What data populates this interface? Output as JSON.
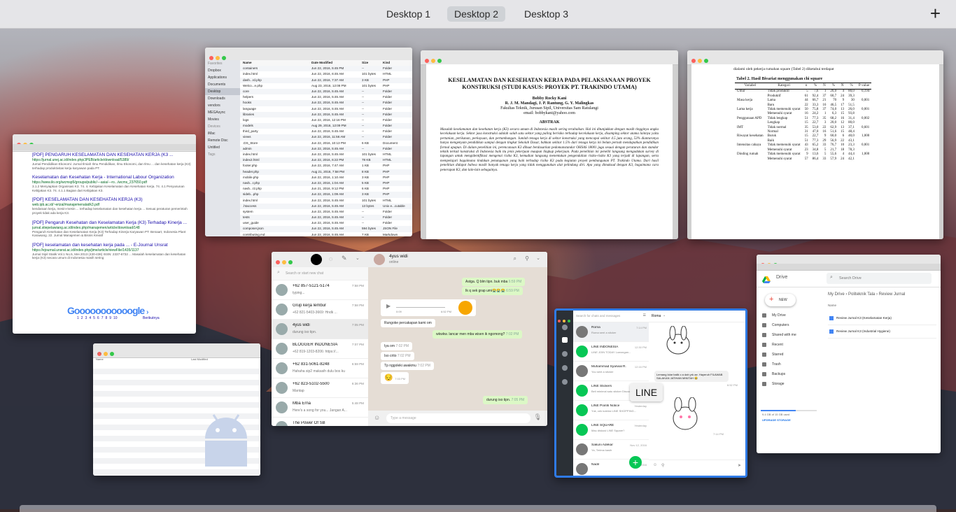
{
  "spaces": {
    "tabs": [
      {
        "label": "Desktop 1",
        "active": false
      },
      {
        "label": "Desktop 2",
        "active": true
      },
      {
        "label": "Desktop 3",
        "active": false
      }
    ],
    "add_label": "+"
  },
  "finder": {
    "sidebar": [
      "Favorites",
      "Dropbox",
      "Applications",
      "Documents",
      "Desktop",
      "Downloads",
      "vendors",
      "MEGAsync",
      "Movies",
      "Devices",
      "iMac",
      "Remote Disc",
      "Untitled",
      "Tags"
    ],
    "columns": [
      "Name",
      "Date Modified",
      "Size",
      "Kind"
    ],
    "rows": [
      [
        "containers",
        "Jun 22, 2016, 5:45 PM",
        "--",
        "Folder"
      ],
      [
        "index.html",
        "Jun 22, 2016, 6:45 AM",
        "101 bytes",
        "HTML"
      ],
      [
        "dash...rd.php",
        "Jun 22, 2016, 7:37 AM",
        "3 KB",
        "PHP"
      ],
      [
        "Welco...e.php",
        "Aug 23, 2016, 12:08 PM",
        "101 bytes",
        "PHP"
      ],
      [
        "core",
        "Jun 22, 2016, 5:45 AM",
        "--",
        "Folder"
      ],
      [
        "helpers",
        "Jun 22, 2016, 5:45 AM",
        "--",
        "Folder"
      ],
      [
        "hooks",
        "Jun 22, 2016, 5:45 AM",
        "--",
        "Folder"
      ],
      [
        "language",
        "Jun 22, 2016, 5:45 AM",
        "--",
        "Folder"
      ],
      [
        "libraries",
        "Jun 22, 2016, 5:45 AM",
        "--",
        "Folder"
      ],
      [
        "logs",
        "Jun 22, 2016, 12:16 PM",
        "--",
        "Folder"
      ],
      [
        "models",
        "Aug 29, 2016, 12:09 PM",
        "--",
        "Folder"
      ],
      [
        "third_party",
        "Jun 22, 2016, 5:45 AM",
        "--",
        "Folder"
      ],
      [
        "views",
        "Jun 22, 2016, 11:56 AM",
        "--",
        "Folder"
      ],
      [
        ".DS_Store",
        "Jun 22, 2016, 10:13 PM",
        "6 KB",
        "Document"
      ],
      [
        "admin",
        "Jun 22, 2016, 5:45 AM",
        "--",
        "Folder"
      ],
      [
        "index.html",
        "Jun 22, 2016, 5:45 AM",
        "101 bytes",
        "HTML"
      ],
      [
        "index2.html",
        "Jun 22, 2016, 6:22 PM",
        "78 KB",
        "HTML"
      ],
      [
        "footer.php",
        "Jun 22, 2016, 7:47 AM",
        "1 KB",
        "PHP"
      ],
      [
        "header.php",
        "Aug 21, 2016, 7:58 PM",
        "8 KB",
        "PHP"
      ],
      [
        "mobile.php",
        "Jun 22, 2016, 1:10 AM",
        "3 KB",
        "PHP"
      ],
      [
        "navb...r.php",
        "Jun 22, 2016, 1:04 AM",
        "5 KB",
        "PHP"
      ],
      [
        "navb...r2.php",
        "Jun 21, 2016, 9:12 PM",
        "6 KB",
        "PHP"
      ],
      [
        "sideb...php",
        "Jun 22, 2016, 1:09 AM",
        "3 KB",
        "PHP"
      ],
      [
        "index.html",
        "Jun 22, 2016, 5:45 AM",
        "101 bytes",
        "HTML"
      ],
      [
        ".htaccess",
        "Jun 22, 2016, 5:45 AM",
        "13 bytes",
        "Unix e...cutable"
      ],
      [
        "system",
        "Jun 22, 2016, 5:45 AM",
        "--",
        "Folder"
      ],
      [
        "tests",
        "Jun 22, 2016, 5:45 AM",
        "--",
        "Folder"
      ],
      [
        "user_guide",
        "Jun 22, 2016, 5:45 AM",
        "--",
        "Folder"
      ],
      [
        "composer.json",
        "Jun 22, 2016, 5:45 AM",
        "594 bytes",
        "JSON File"
      ],
      [
        "contributing.md",
        "Jun 22, 2016, 5:45 AM",
        "7 KB",
        "Markdown"
      ],
      [
        "index.php",
        "Jun 22, 2016, 5:45 AM",
        "10 KB",
        "PHP"
      ],
      [
        "license.txt",
        "Jun 22, 2016, 5:45 AM",
        "3 KB",
        "Plain Text"
      ],
      [
        "Screen S...3.49 PM.png",
        "Jun 23, 2016, 3:49 PM",
        "32 KB",
        "PNG image"
      ]
    ]
  },
  "pdf1": {
    "title": "KESELAMATAN DAN KESEHATAN KERJA PADA PELAKSANAAN PROYEK KONSTRUKSI (STUDI KASUS: PROYEK PT. TRAKINDO UTAMA)",
    "author": "Bobby Rocky Kani",
    "authors2": "R. J. M. Mandagi, J. P. Rantung, G. Y. Malingkas",
    "affiliation": "Fakultas Teknik, Jurusan Sipil, Universitas Sam Ratulangi",
    "email": "email: bobbykani@yahoo.com",
    "abstract_head": "ABSTRAK",
    "abstract": "Masalah keselamatan dan kesehatan kerja (K3) secara umum di Indonesia masih sering terabaikan. Hal ini ditunjukkan dengan masih tingginya angka kecelakaan kerja. Sektor jasa konstruksi adalah salah satu sektor yang paling berisiko terhadap kecelakaan kerja, disamping sektor utama lainnya yaitu pertanian, perikanan, perkayuan, dan pertambangan. Jumlah tenaga kerja di sektor konstruksi yang mencapai sekitar 4.5 juta orang, 53% diantaranya hanya mengenyam pendidikan sampai dengan tingkat Sekolah Dasar, bahkan sekitar 1.5% dari tenaga kerja ini belum pernah mendapatkan pendidikan formal apapun. Di dalam penelitian ini, perencanaan K3 dibuat berdasarkan pedomanstandar OHSAS 18001 juga sesuai dengan peraturan dan standar teknik terkait konstruksi di Indonesia baik itu jenis pekerjaan maupun lingkup pekerjaan. Pada penelitian ini peneliti langsung mengadakan survey di lapangan untuk mengidentifikasi mengenai risiko K3, kemudian langsung menentukan pengendalian risiko-risiko K3 yang terjadi di lapangan, serta mempelajari bagaimana tindakan penanganan yang baik terhadap risiko K3 pada kegiatan proyek pembangunan PT. Trakindo Utama. Dari hasil penelitian didapat bahwa masih banyak tenaga kerja yang tidak menggunakan alat pelindung diri. Apa yang dimaksud dengan K3, bagaimana cara penerapan K3, dan lain-lain sebagainya."
  },
  "pdf2": {
    "intro": "dialami oleh pekerja rumahan square (Tabel 2) diketahui terdapat",
    "table_title": "Tabel 2. Hasil Bivariat menggunakan chi square",
    "headers": [
      "Variabel",
      "Kategori",
      "n",
      "%",
      "N",
      "%",
      "N",
      "%",
      "P-value"
    ],
    "rows": [
      [
        "Umur",
        "Tidak produktif",
        "5",
        "7,6",
        "1",
        "20,0",
        "4",
        "80,0",
        "0,194"
      ],
      [
        "",
        "Produktif",
        "61",
        "92,4",
        "37",
        "60,7",
        "24",
        "39,3",
        ""
      ],
      [
        "Masa kerja",
        "Lama",
        "44",
        "66,7",
        "21",
        "70",
        "9",
        "30",
        "0,001"
      ],
      [
        "",
        "Baru",
        "22",
        "33,3",
        "16",
        "46,5",
        "17",
        "51,5",
        ""
      ],
      [
        "Lama kerja",
        "Tidak memenuhi syarat",
        "50",
        "75,8",
        "37",
        "74,0",
        "13",
        "26,0",
        "0,001"
      ],
      [
        "",
        "Memenuhi syarat",
        "16",
        "24,2",
        "1",
        "6,3",
        "15",
        "93,8",
        ""
      ],
      [
        "Penggunaan APD",
        "Tidak lengkap",
        "51",
        "77,3",
        "35",
        "68,2",
        "16",
        "31,4",
        "0,002"
      ],
      [
        "",
        "Lengkap",
        "15",
        "22,7",
        "3",
        "20,0",
        "12",
        "80,0",
        ""
      ],
      [
        "IMT",
        "Tidak normal",
        "35",
        "53,0",
        "22",
        "62,9",
        "13",
        "37,1",
        "0,601"
      ],
      [
        "",
        "Normal",
        "31",
        "47,0",
        "16",
        "51,6",
        "15",
        "48,4",
        ""
      ],
      [
        "Riwayat kesehatan",
        "Buruk",
        "15",
        "22,7",
        "9",
        "60,0",
        "6",
        "40,0",
        "1,000"
      ],
      [
        "",
        "Baik",
        "51",
        "77,3",
        "29",
        "56,9",
        "22",
        "43,1",
        ""
      ],
      [
        "Intensitas cahaya",
        "Tidak memenuhi syarat",
        "43",
        "65,2",
        "33",
        "76,7",
        "10",
        "23,3",
        "0,001"
      ],
      [
        "",
        "Memenuhi syarat",
        "23",
        "34,8",
        "5",
        "21,7",
        "18",
        "78,3",
        ""
      ],
      [
        "Dinding rumah",
        "Tidak memenuhi syarat",
        "9",
        "13,6",
        "5",
        "55,6",
        "4",
        "44,4",
        "1,000"
      ],
      [
        "",
        "Memenuhi syarat",
        "57",
        "86,4",
        "33",
        "57,9",
        "24",
        "42,1",
        ""
      ]
    ]
  },
  "google": {
    "results": [
      {
        "title": "[PDF] PENGARUH KESELAMATAN DAN KESEHATAN KERJA (K3 ...",
        "url": "https://jurnal.unej.ac.id/index.php/JPEB/article/download/5389/",
        "desc": "Jurnal Pendidikan Ekonomi: Jurnal Ilmiah Ilmu Pendidikan, Ilmu Ekonomi, dan Ilmu ... dan kesehatan kerja (K3) terhadap produktivitas kerja karyawan pada PT."
      },
      {
        "title": "Keselamatan dan Kesehatan Kerja - International Labour Organization",
        "url": "https://www.ilo.org/wcmsp5/groups/public/---asia/---ro.../wcms_237650.pdf",
        "desc": "3.1.2 Menyiapkan Organisasi K3. 74. 4. Kebijakan Keselamatan dan Kesehatan Kerja. 74. 4.1 Penyusunan Kebijakan K3. 74. 4.1.1 Bagian dari Kebijakan K3."
      },
      {
        "title": "[PDF] KESELAMATAN DAN KESEHATAN KERJA (K3)",
        "url": "web.ipb.ac.id/~erizal/manajemenalat/k3.pdf",
        "desc": "kendaraan kerja, mesin-mesin ... terhadap keselamatan dan kesehatan kerja ... Sesuai peraturan pemerintah proyek tidak ada kerja K3."
      },
      {
        "title": "[PDF] Pengaruh Kesehatan dan Keselamatan Kerja (K3) Terhadap Kinerja ...",
        "url": "jurnal.stiepelawiang.ac.id/index.php/manajemen/article/download/148",
        "desc": "Pengaruh Kesehatan dan Keselamatan Kerja (K3) Terhadap Kinerja Karyawan PT. Benaart, Indonesia Plant Karawang. 22. Jurnal Manajemen & Bisnis Kreatif"
      },
      {
        "title": "[PDF] keselamatan dan kesehatan kerja pada ... - E-Journal Unsrat",
        "url": "https://ejournal.unsrat.ac.id/index.php/jime/article/viewFile/1435/1137",
        "desc": "Jurnal Sipil Statik Vol.1 No.5, Mei 2013 (430-436) ISSN: 2337-6732 ... Masalah keselamatan dan kesehatan kerja (K3) secara umum di Indonesia masih sering"
      }
    ],
    "pager": "Gooooooooooogle",
    "pages": [
      "1",
      "2",
      "3",
      "4",
      "5",
      "6",
      "7",
      "8",
      "9",
      "10"
    ],
    "next": "Berikutnya"
  },
  "blank": {
    "col1": "Name",
    "col2": "Last Modified"
  },
  "whatsapp": {
    "header": {
      "name": "4yus widi",
      "status": "online"
    },
    "search_placeholder": "Search or start new chat",
    "chats": [
      {
        "name": "+62 857-5121-5174",
        "preview": "typing...",
        "time": "7:58 PM"
      },
      {
        "name": "Grup kerja lembur",
        "preview": "+62 821-5403-3669: Hndk ...",
        "time": "7:58 PM"
      },
      {
        "name": "4yus widi",
        "preview": "durung iso tipn.",
        "time": "7:05 PM"
      },
      {
        "name": "BLOGGER INDONESIA",
        "preview": "+62 819-1203-8206: https://...",
        "time": "7:07 PM"
      },
      {
        "name": "+62 831-5061-8248",
        "preview": "Hahaha sip2 makasih dulu bos ku",
        "time": "6:59 PM"
      },
      {
        "name": "+62 823-5102-5500",
        "preview": "Mantap",
        "time": "6:36 PM"
      },
      {
        "name": "Mba Erna",
        "preview": "Here's a song for you... Jangan A...",
        "time": "5:48 PM"
      },
      {
        "name": "The Power Of SB",
        "preview": "",
        "time": ""
      }
    ],
    "messages": [
      {
        "text": "Astga. Q blm tipn. buk mba",
        "time": "6:59 PM",
        "dir": "out"
      },
      {
        "text": "Ik q sek grap umi😭😭😭",
        "time": "6:59 PM",
        "dir": "out"
      },
      {
        "text": "0:09",
        "time": "6:52 PM",
        "dir": "in"
      },
      {
        "text": "Rungoke percakapan kami om",
        "time": "",
        "dir": "in"
      },
      {
        "text": "wkwkw. lancar men mba wisen ik ngomong?",
        "time": "7:02 PM",
        "dir": "out"
      },
      {
        "text": "Iya om",
        "time": "7:02 PM",
        "dir": "in"
      },
      {
        "text": "Iso crito",
        "time": "7:02 PM",
        "dir": "in"
      },
      {
        "text": "Tp nggoleki awakmu",
        "time": "7:02 PM",
        "dir": "in"
      },
      {
        "text": "😔",
        "time": "7:03 PM",
        "dir": "in"
      },
      {
        "text": "durung iso tipn.",
        "time": "7:05 PM",
        "dir": "out"
      }
    ],
    "input_placeholder": "Type a message"
  },
  "line": {
    "label": "LINE",
    "search_placeholder": "Search for chats and messages",
    "chat_title": "Roma",
    "chats": [
      {
        "name": "Roma",
        "preview": "Roma sent a sticker",
        "time": "7:14 PM"
      },
      {
        "name": "LINE INDONESIA",
        "preview": "LINE JOIN TODAY Lowongan...",
        "time": "12:30 PM"
      },
      {
        "name": "Muhammad Syarwal R.",
        "preview": "You sent a sticker",
        "time": "12:16 PM"
      },
      {
        "name": "LINE Stickers",
        "preview": "Beli minimal satu sticker Discount ...",
        "time": "12:00 PM"
      },
      {
        "name": "LINE Points Notice",
        "preview": "Yuk, cek koleksi LINE SHOPPING...",
        "time": "Yesterday"
      },
      {
        "name": "LINE SQUARE",
        "preview": "Mau diskusi LINE Square?",
        "time": "Yesterday"
      },
      {
        "name": "Sakuni Adekar",
        "preview": "Ya, Terima kasih",
        "time": "Nov 12, 2016"
      },
      {
        "name": "Nadil",
        "preview": "",
        "time": "Nov 12, 2016"
      }
    ],
    "messages": [
      {
        "text": "Lemang lolar balik c a dah yrk ae. Hayeruh FILAWAB SALAKAN JATIHAN MINITAH 😂",
        "time": "6:52 PM"
      }
    ],
    "sticker_time": "7:14 PM"
  },
  "drive": {
    "brand": "Drive",
    "new_label": "NEW",
    "search_placeholder": "Search Drive",
    "breadcrumb": [
      "My Drive",
      "Politeknik Tala",
      "Review Jurnal"
    ],
    "sidebar": [
      "My Drive",
      "Computers",
      "Shared with me",
      "Recent",
      "Starred",
      "Trash",
      "Backups",
      "Storage"
    ],
    "storage_text": "9.4 GB of 15 GB used",
    "upgrade": "UPGRADE STORAGE",
    "list_header": "Name",
    "files": [
      "Review Jurnal K3 (Keselamatan Kerja)",
      "Review Jurnal K3 (Industrial Hygiene)"
    ]
  },
  "colors": {
    "wa_green": "#25d366",
    "line_green": "#06c755",
    "drive_blue": "#4285f4",
    "selection_blue": "#2f7ae5"
  }
}
